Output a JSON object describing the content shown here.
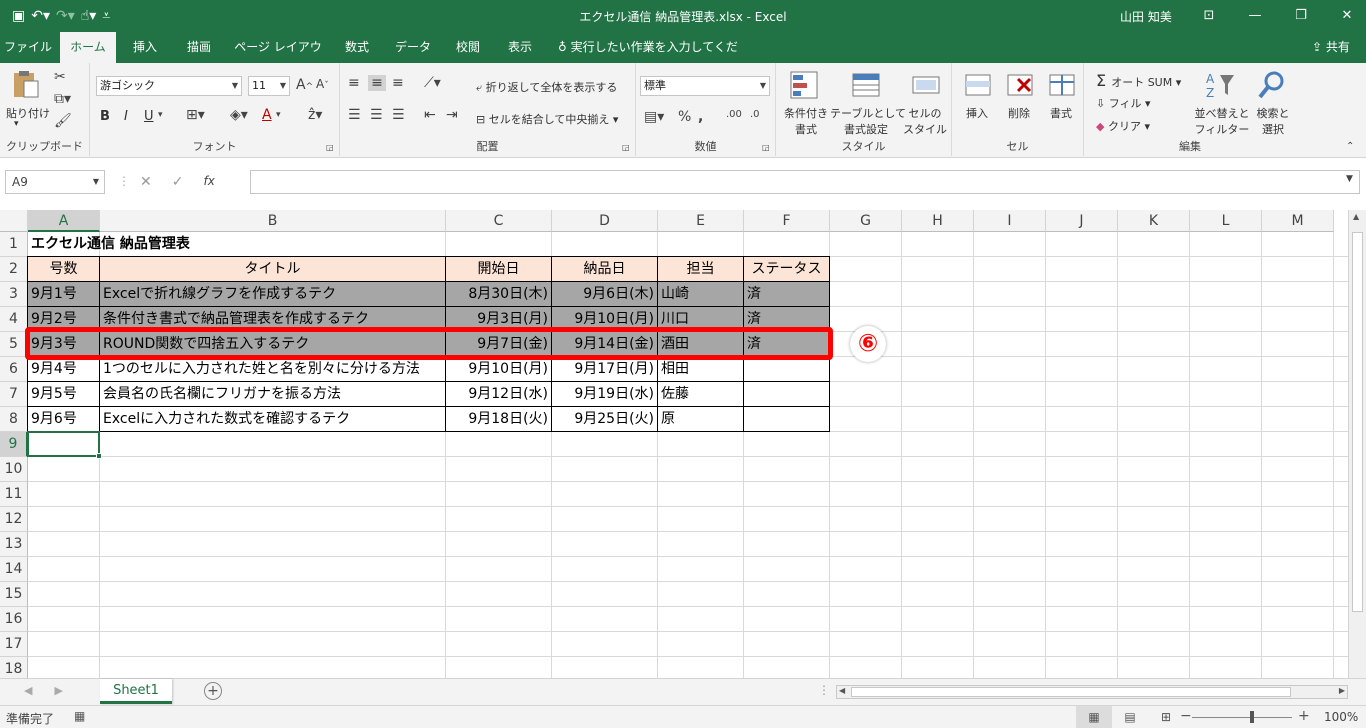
{
  "titlebar": {
    "title": "エクセル通信 納品管理表.xlsx  -  Excel",
    "user": "山田 知美"
  },
  "tabs": [
    "ファイル",
    "ホーム",
    "挿入",
    "描画",
    "ページ レイアウト",
    "数式",
    "データ",
    "校閲",
    "表示"
  ],
  "tell_me": "実行したい作業を入力してください",
  "share": "共有",
  "ribbon": {
    "clipboard": {
      "paste": "貼り付け",
      "label": "クリップボード"
    },
    "font": {
      "name": "游ゴシック",
      "size": "11",
      "bold": "B",
      "italic": "I",
      "underline": "U",
      "label": "フォント"
    },
    "alignment": {
      "wrap": "折り返して全体を表示する",
      "merge": "セルを結合して中央揃え",
      "label": "配置"
    },
    "number": {
      "format": "標準",
      "label": "数値"
    },
    "styles": {
      "conditional": [
        "条件付き",
        "書式"
      ],
      "table": [
        "テーブルとして",
        "書式設定"
      ],
      "cell": [
        "セルの",
        "スタイル"
      ],
      "label": "スタイル"
    },
    "cells": {
      "insert": "挿入",
      "delete": "削除",
      "format": "書式",
      "label": "セル"
    },
    "editing": {
      "autosum": "オート SUM",
      "fill": "フィル",
      "clear": "クリア",
      "sort": [
        "並べ替えと",
        "フィルター"
      ],
      "find": [
        "検索と",
        "選択"
      ],
      "label": "編集"
    }
  },
  "formula": {
    "namebox": "A9",
    "fx": "fx"
  },
  "sheet": {
    "columns": [
      "A",
      "B",
      "C",
      "D",
      "E",
      "F",
      "G",
      "H",
      "I",
      "J",
      "K",
      "L",
      "M"
    ],
    "rows": [
      "1",
      "2",
      "3",
      "4",
      "5",
      "6",
      "7",
      "8",
      "9",
      "10",
      "11",
      "12",
      "13",
      "14",
      "15",
      "16",
      "17",
      "18"
    ],
    "title": "エクセル通信 納品管理表",
    "headers": [
      "号数",
      "タイトル",
      "開始日",
      "納品日",
      "担当",
      "ステータス"
    ],
    "data": [
      [
        "9月1号",
        "Excelで折れ線グラフを作成するテク",
        "8月30日(木)",
        "9月6日(木)",
        "山崎",
        "済"
      ],
      [
        "9月2号",
        "条件付き書式で納品管理表を作成するテク",
        "9月3日(月)",
        "9月10日(月)",
        "川口",
        "済"
      ],
      [
        "9月3号",
        "ROUND関数で四捨五入するテク",
        "9月7日(金)",
        "9月14日(金)",
        "酒田",
        "済"
      ],
      [
        "9月4号",
        "1つのセルに入力された姓と名を別々に分ける方法",
        "9月10日(月)",
        "9月17日(月)",
        "相田",
        ""
      ],
      [
        "9月5号",
        "会員名の氏名欄にフリガナを振る方法",
        "9月12日(水)",
        "9月19日(水)",
        "佐藤",
        ""
      ],
      [
        "9月6号",
        "Excelに入力された数式を確認するテク",
        "9月18日(火)",
        "9月25日(火)",
        "原",
        ""
      ]
    ],
    "annotation": "⑥"
  },
  "sheet_tab": "Sheet1",
  "status": {
    "ready": "準備完了",
    "zoom": "100%"
  }
}
